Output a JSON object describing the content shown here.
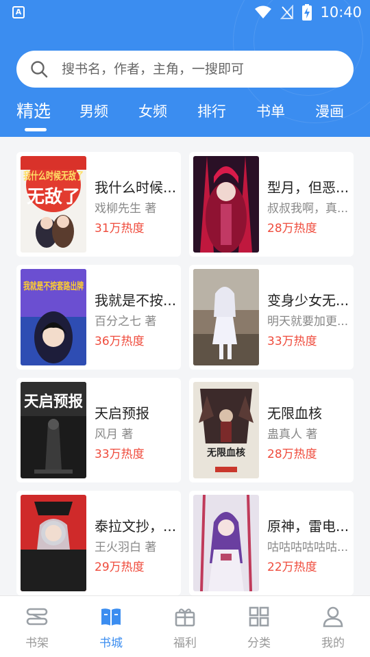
{
  "status_bar": {
    "time": "10:40",
    "app_icon_letter": "A"
  },
  "search": {
    "placeholder": "搜书名，作者，主角，一搜即可"
  },
  "tabs": [
    {
      "label": "精选",
      "active": true
    },
    {
      "label": "男频"
    },
    {
      "label": "女频"
    },
    {
      "label": "排行"
    },
    {
      "label": "书单"
    },
    {
      "label": "漫画"
    }
  ],
  "books": [
    {
      "title": "我什么时候...",
      "author": "戏柳先生 著",
      "heat": "31万热度",
      "cover_text": "我什么时候无敌了"
    },
    {
      "title": "型月，但恶...",
      "author": "叔叔我啊，真...",
      "heat": "28万热度"
    },
    {
      "title": "我就是不按...",
      "author": "百分之七 著",
      "heat": "36万热度",
      "cover_text": "我就是不按套路出牌"
    },
    {
      "title": "变身少女无...",
      "author": "明天就要加更...",
      "heat": "33万热度"
    },
    {
      "title": "天启预报",
      "author": "风月 著",
      "heat": "33万热度",
      "cover_text": "天启预报"
    },
    {
      "title": "无限血核",
      "author": "蛊真人 著",
      "heat": "28万热度",
      "cover_text": "无限血核"
    },
    {
      "title": "泰拉文抄，...",
      "author": "王火羽白 著",
      "heat": "29万热度"
    },
    {
      "title": "原神，雷电...",
      "author": "咕咕咕咕咕咕...",
      "heat": "22万热度"
    }
  ],
  "bottom_nav": [
    {
      "label": "书架",
      "icon": "bookshelf-icon"
    },
    {
      "label": "书城",
      "icon": "bookstore-icon",
      "active": true
    },
    {
      "label": "福利",
      "icon": "gift-icon"
    },
    {
      "label": "分类",
      "icon": "grid-icon"
    },
    {
      "label": "我的",
      "icon": "user-icon"
    }
  ],
  "colors": {
    "primary": "#3b8df0",
    "heat": "#ef4b3c",
    "background": "#f4f5f7"
  }
}
